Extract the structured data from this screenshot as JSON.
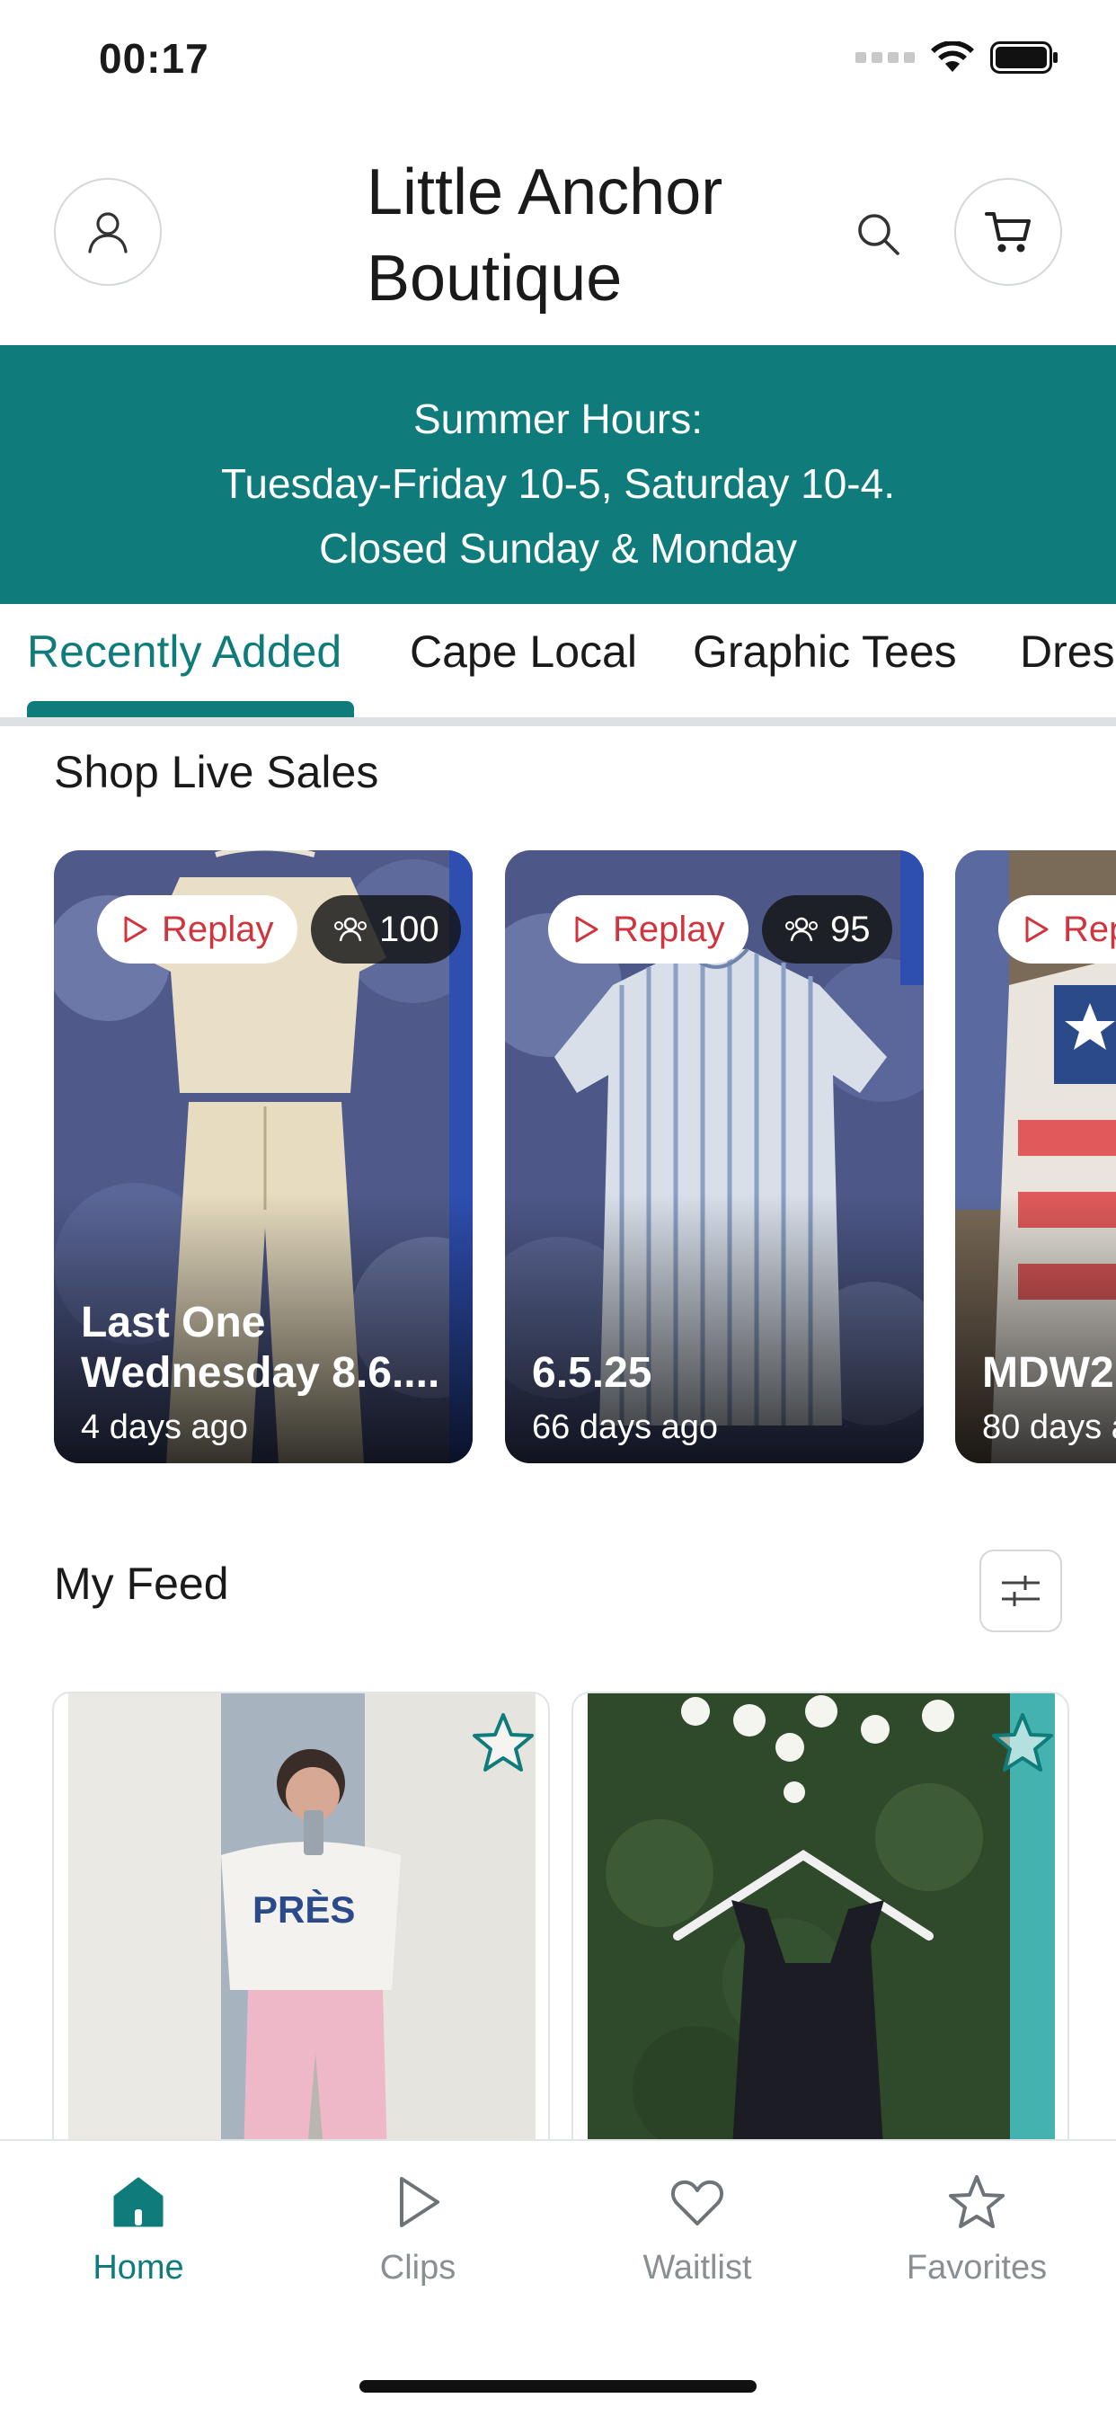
{
  "status_bar": {
    "time": "00:17"
  },
  "header": {
    "title_line1": "Little Anchor",
    "title_line2": "Boutique",
    "icons": {
      "profile": "user-icon",
      "search": "search-icon",
      "cart": "cart-icon"
    }
  },
  "banner": {
    "line1": "Summer Hours:",
    "line2": "Tuesday-Friday 10-5, Saturday 10-4.",
    "line3": "Closed Sunday & Monday"
  },
  "tabs": [
    {
      "label": "Recently Added",
      "active": true
    },
    {
      "label": "Cape Local",
      "active": false
    },
    {
      "label": "Graphic Tees",
      "active": false
    },
    {
      "label": "Dres",
      "active": false
    }
  ],
  "live_sales": {
    "title": "Shop Live Sales",
    "cards": [
      {
        "replay": "Replay",
        "viewers": "100",
        "title": "Last One Wednesday 8.6....",
        "age": "4 days ago"
      },
      {
        "replay": "Replay",
        "viewers": "95",
        "title": "6.5.25",
        "age": "66 days ago"
      },
      {
        "replay": "Rep",
        "viewers": "",
        "title": "MDW2",
        "age": "80 days a"
      }
    ]
  },
  "feed": {
    "title": "My Feed",
    "filter_icon": "sliders-icon"
  },
  "bottom_nav": [
    {
      "label": "Home",
      "icon": "home-icon",
      "active": true
    },
    {
      "label": "Clips",
      "icon": "play-icon",
      "active": false
    },
    {
      "label": "Waitlist",
      "icon": "heart-icon",
      "active": false
    },
    {
      "label": "Favorites",
      "icon": "star-icon",
      "active": false
    }
  ],
  "colors": {
    "accent": "#0f7b7b",
    "replay_red": "#d0353f",
    "inactive": "#8a8f93"
  }
}
